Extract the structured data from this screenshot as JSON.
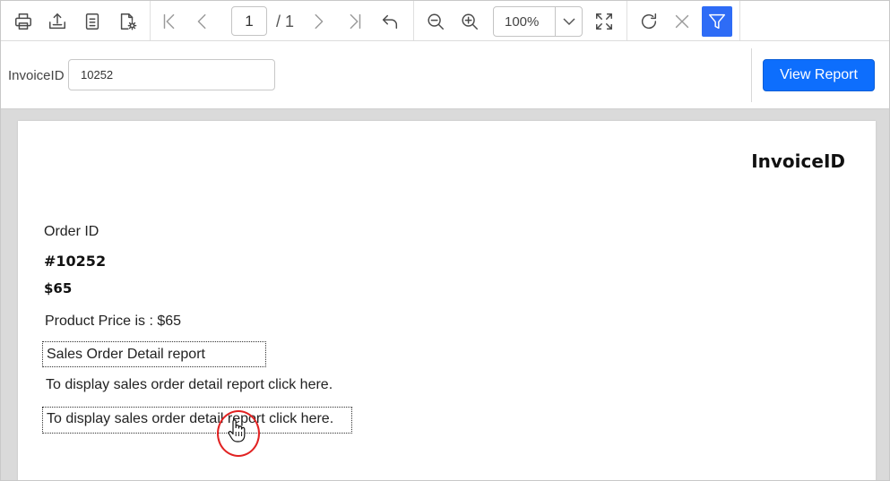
{
  "toolbar": {
    "icons": [
      "print-icon",
      "export-icon",
      "document-icon",
      "page-setup-icon",
      "first-page-icon",
      "previous-page-icon",
      "next-page-icon",
      "last-page-icon",
      "back-icon",
      "zoom-out-icon",
      "zoom-in-icon",
      "fit-page-icon",
      "refresh-icon",
      "cancel-icon",
      "filter-icon"
    ],
    "current_page": "1",
    "total_pages": "/ 1",
    "zoom": "100%",
    "active_color": "#2e6cf6"
  },
  "parameters": {
    "label": "InvoiceID",
    "value": "10252",
    "view_button": "View Report",
    "button_color": "#0d6efd"
  },
  "report": {
    "title": "InvoiceID",
    "order_label": "Order ID",
    "order_value": "#10252",
    "price_value": "$65",
    "product_price_text": "Product Price is : $65",
    "sales_detail_box": "Sales Order Detail report",
    "display_text": "To display sales order detail report click here.",
    "display_link_box": "To display sales order detail report click here."
  }
}
